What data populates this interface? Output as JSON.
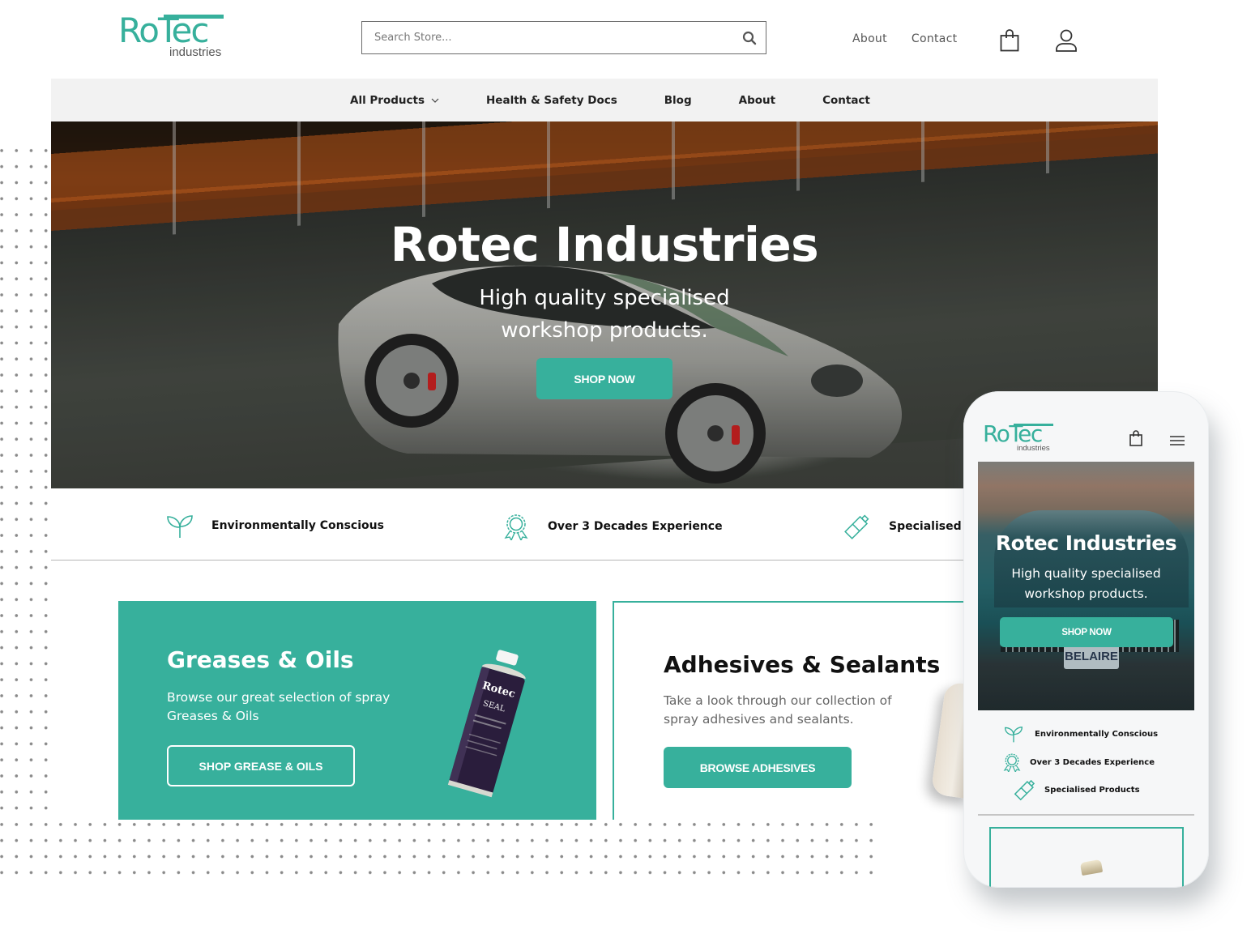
{
  "brand": {
    "logo_mark": "RoTec",
    "logo_sub": "industries",
    "accent_color": "#37b09c"
  },
  "header": {
    "search_placeholder": "Search Store...",
    "search_icon": "search-icon",
    "links": [
      "About",
      "Contact"
    ],
    "cart_icon": "shopping-bag-icon",
    "account_icon": "user-icon"
  },
  "nav": {
    "items": [
      {
        "label": "All Products",
        "has_dropdown": true
      },
      {
        "label": "Health & Safety Docs"
      },
      {
        "label": "Blog"
      },
      {
        "label": "About"
      },
      {
        "label": "Contact"
      }
    ]
  },
  "hero": {
    "title": "Rotec Industries",
    "subtitle_line1": "High quality specialised",
    "subtitle_line2": "workshop products.",
    "cta": "SHOP NOW"
  },
  "features": [
    {
      "icon": "sprout-icon",
      "label": "Environmentally Conscious"
    },
    {
      "icon": "award-ribbon-icon",
      "label": "Over 3 Decades Experience"
    },
    {
      "icon": "spray-can-icon",
      "label": "Specialised Products"
    }
  ],
  "cards": {
    "greases": {
      "title": "Greases & Oils",
      "text": "Browse our great selection of spray Greases & Oils",
      "cta": "SHOP GREASE & OILS",
      "product_brand": "Rotec",
      "product_name": "SEAL"
    },
    "adhesives": {
      "title": "Adhesives & Sealants",
      "text": "Take a look through our collection of spray adhesives and sealants.",
      "cta": "BROWSE ADHESIVES"
    }
  },
  "mobile": {
    "logo_mark": "RoTec",
    "logo_sub": "industries",
    "cart_icon": "shopping-bag-icon",
    "menu_icon": "hamburger-menu-icon",
    "hero_title": "Rotec Industries",
    "hero_subtitle_line1": "High quality specialised",
    "hero_subtitle_line2": "workshop products.",
    "hero_cta": "SHOP NOW",
    "plate_text": "BELAIRE",
    "features": [
      {
        "icon": "sprout-icon",
        "label": "Environmentally Conscious"
      },
      {
        "icon": "award-ribbon-icon",
        "label": "Over 3 Decades Experience"
      },
      {
        "icon": "spray-can-icon",
        "label": "Specialised Products"
      }
    ]
  }
}
